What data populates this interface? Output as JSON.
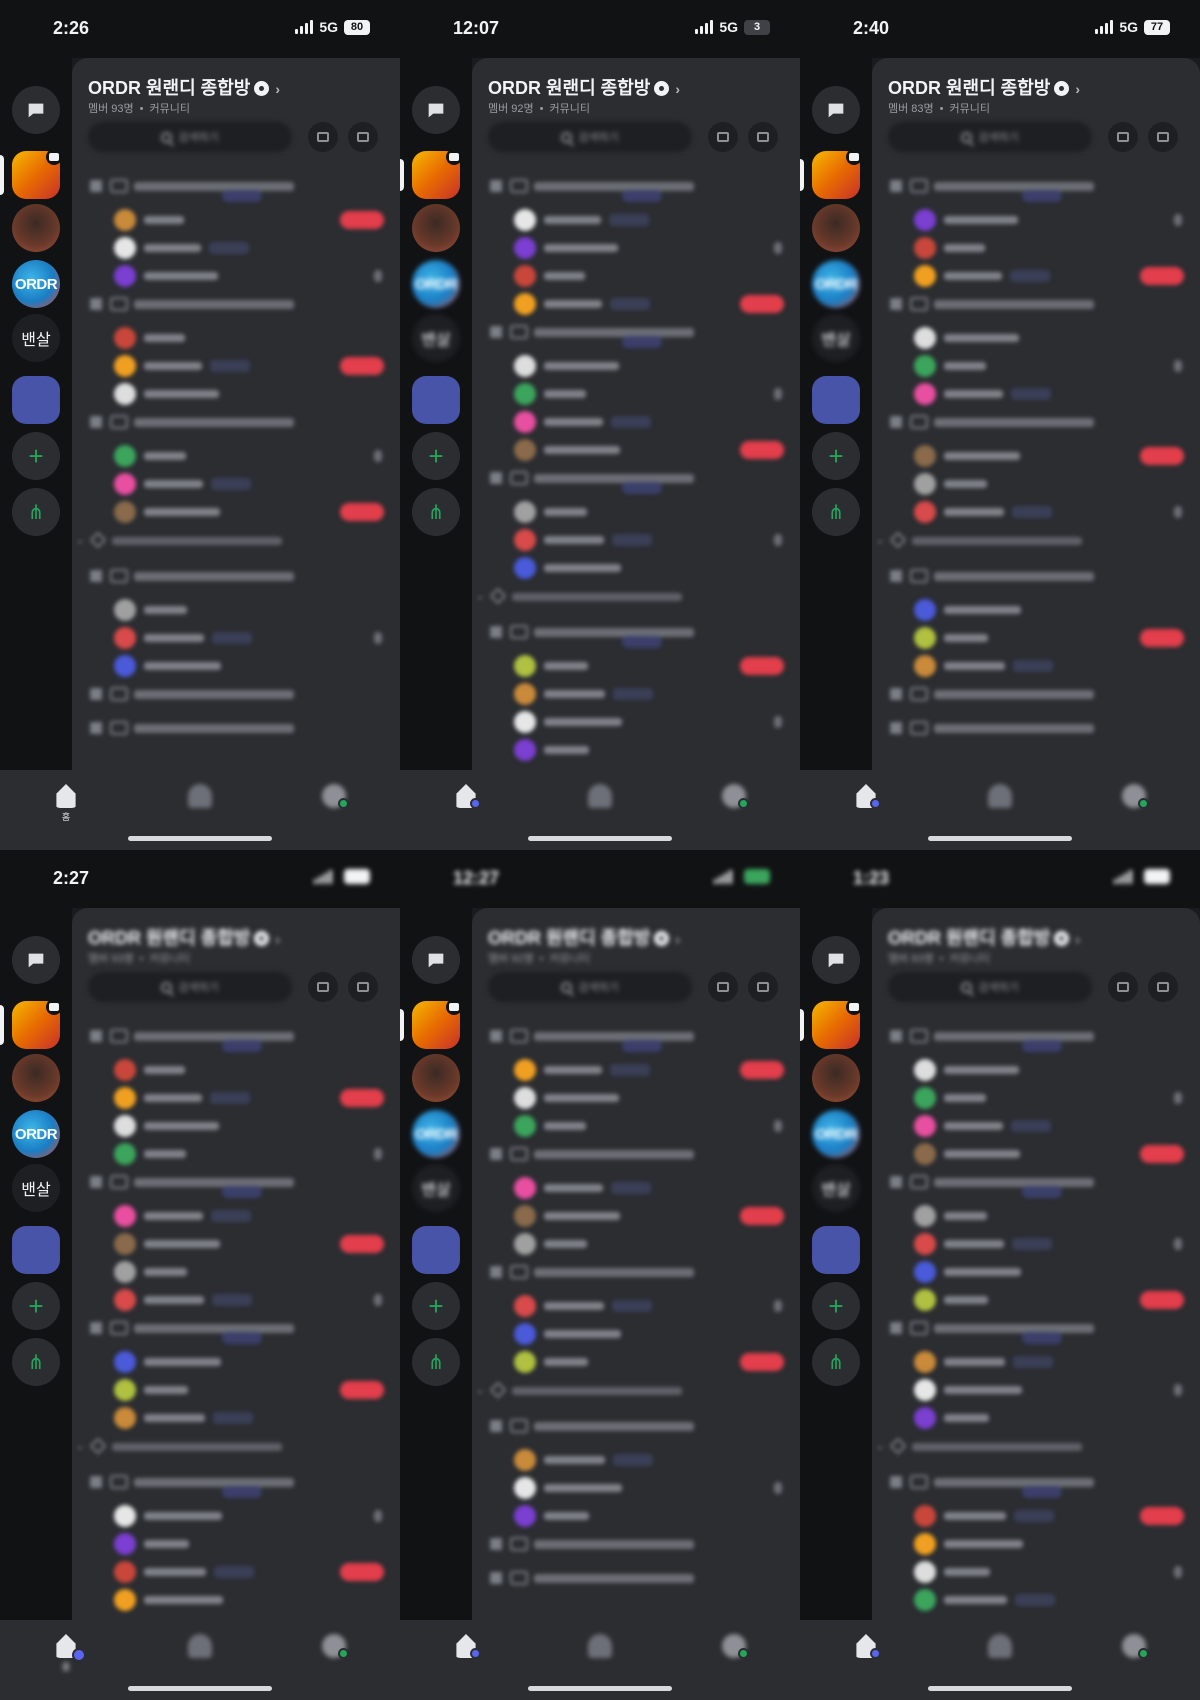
{
  "screens": [
    {
      "time": "2:26",
      "net": "5G",
      "battery": "80"
    },
    {
      "time": "12:07",
      "net": "5G",
      "battery": "3"
    },
    {
      "time": "2:40",
      "net": "5G",
      "battery": "77"
    },
    {
      "time": "2:27",
      "net": "",
      "battery": ""
    },
    {
      "time": "12:27",
      "net": "",
      "battery": ""
    },
    {
      "time": "1:23",
      "net": "",
      "battery": ""
    }
  ],
  "server": {
    "name": "ORDR 원랜디 종합방",
    "members": [
      "멤버 93명",
      "멤버 92명",
      "멤버 83명"
    ],
    "community": "커뮤니티",
    "search_placeholder": "검색하기"
  },
  "rail": {
    "ordr_label": "ORDR",
    "banshal_label": "밴살"
  },
  "tabs": {
    "home": "홈"
  },
  "colors": {
    "bg": "#1a1b1e",
    "rail": "#111214",
    "panel": "#2b2d31",
    "live": "#e23e4b",
    "online": "#23a55a",
    "accent": "#5865f2"
  }
}
